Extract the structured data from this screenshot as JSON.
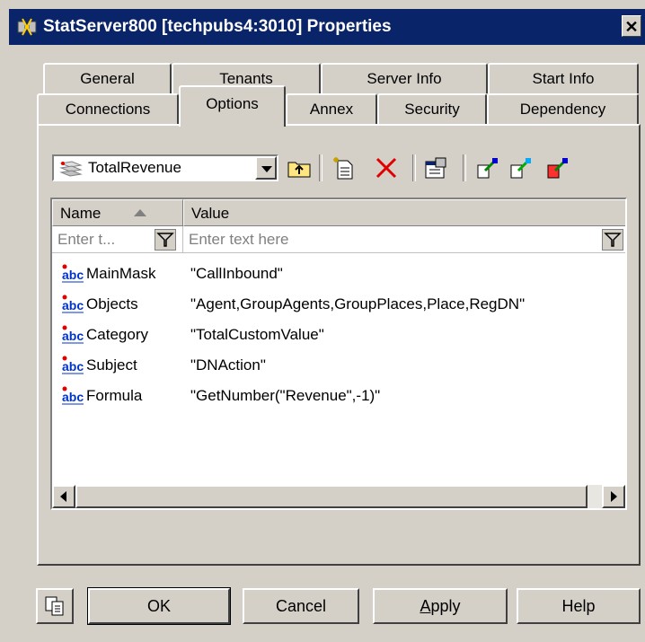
{
  "window": {
    "title": "StatServer800 [techpubs4:3010] Properties",
    "close": "✕"
  },
  "tabs_row_top": [
    "General",
    "Tenants",
    "Server Info",
    "Start Info"
  ],
  "tabs_row_bottom": [
    "Connections",
    "Options",
    "Annex",
    "Security",
    "Dependency"
  ],
  "active_tab": "Options",
  "section_combo": {
    "value": "TotalRevenue"
  },
  "list": {
    "columns": [
      "Name",
      "Value"
    ],
    "filter_placeholders": [
      "Enter t...",
      "Enter text here"
    ],
    "rows": [
      {
        "name": "MainMask",
        "value": "\"CallInbound\""
      },
      {
        "name": "Objects",
        "value": "\"Agent,GroupAgents,GroupPlaces,Place,RegDN\""
      },
      {
        "name": "Category",
        "value": "\"TotalCustomValue\""
      },
      {
        "name": "Subject",
        "value": "\"DNAction\""
      },
      {
        "name": "Formula",
        "value": "\"GetNumber(\"Revenue\",-1)\""
      }
    ]
  },
  "buttons": {
    "ok": "OK",
    "cancel": "Cancel",
    "apply_first": "A",
    "apply_rest": "pply",
    "help": "Help"
  },
  "colors": {
    "titlebar": "#0a246a",
    "face": "#d4d0c8",
    "abc_icon": "#0033cc",
    "delete_icon": "#e00000"
  }
}
